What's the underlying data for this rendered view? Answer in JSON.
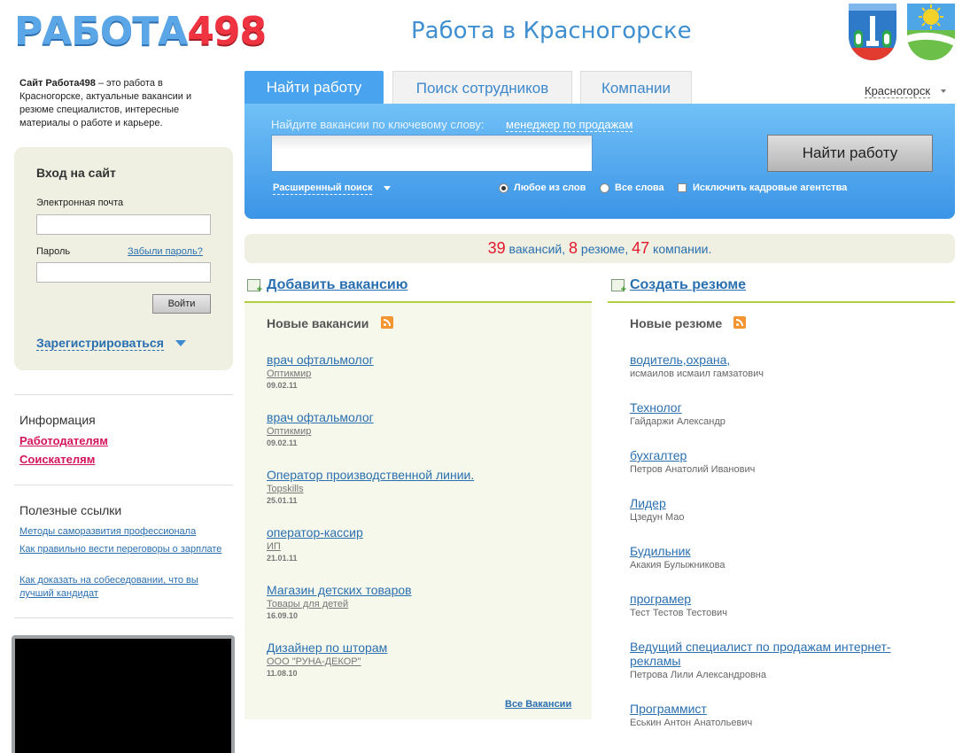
{
  "header": {
    "logo_part1": "РАБОТА",
    "logo_part2": "498",
    "title": "Работа в Красногорске"
  },
  "intro": {
    "site_name": "Сайт Работа498",
    "text": " – это работа в Красногорске, актуальные вакансии и резюме специалистов, интересные материалы о работе и карьере."
  },
  "login": {
    "title": "Вход на сайт",
    "email_label": "Электронная почта",
    "password_label": "Пароль",
    "forgot_link": "Забыли пароль?",
    "submit_label": "Войти",
    "register_link": "Зарегистрироваться"
  },
  "info": {
    "heading": "Информация",
    "links": [
      "Работодателям",
      "Соискателям"
    ]
  },
  "useful": {
    "heading": "Полезные ссылки",
    "links": [
      "Методы саморазвития профессионала",
      "Как правильно вести переговоры о зарплате",
      "Как доказать на собеседовании, что вы лучший кандидат"
    ]
  },
  "tabs": [
    "Найти работу",
    "Поиск сотрудников",
    "Компании"
  ],
  "city_selector": "Красногорск",
  "search": {
    "hint": "Найдите вакансии по ключевому слову:",
    "hint_example": "менеджер по продажам",
    "input_value": "",
    "button_label": "Найти работу",
    "advanced_link": "Расширенный поиск",
    "options": [
      "Любое из слов",
      "Все слова",
      "Исключить кадровые агентства"
    ]
  },
  "stats": {
    "vacancies_count": "39",
    "vacancies_label": "вакансий",
    "resumes_count": "8",
    "resumes_label": "резюме",
    "companies_count": "47",
    "companies_label": "компании"
  },
  "vacancies": {
    "add_link": "Добавить вакансию",
    "heading": "Новые вакансии",
    "all_link": "Все Вакансии",
    "items": [
      {
        "title": "врач офтальмолог",
        "company": "Оптикмир",
        "date": "09.02.11"
      },
      {
        "title": "врач офтальмолог",
        "company": "Оптикмир",
        "date": "09.02.11"
      },
      {
        "title": "Оператор производственной линии.",
        "company": "Topskills",
        "date": "25.01.11"
      },
      {
        "title": "оператор-кассир",
        "company": "ИП",
        "date": "21.01.11"
      },
      {
        "title": "Магазин детских товаров",
        "company": "Товары для детей",
        "date": "16.09.10"
      },
      {
        "title": "Дизайнер по шторам",
        "company": "ООО \"РУНА-ДЕКОР\"",
        "date": "11.08.10"
      }
    ]
  },
  "resumes": {
    "add_link": "Создать резюме",
    "heading": "Новые резюме",
    "items": [
      {
        "title": "водитель,охрана,",
        "name": "исмаилов исмаил гамзатович"
      },
      {
        "title": "Технолог",
        "name": "Гайдаржи Александр"
      },
      {
        "title": "бухгалтер",
        "name": "Петров Анатолий Иванович"
      },
      {
        "title": "Лидер",
        "name": "Цзедун Мао"
      },
      {
        "title": "Будильник",
        "name": "Акакия Булыжникова"
      },
      {
        "title": "програмер",
        "name": "Тест Тестов Тестович"
      },
      {
        "title": "Ведущий специалист по продажам интернет-рекламы",
        "name": "Петрова Лили Александровна"
      },
      {
        "title": "Программист",
        "name": "Еськин Антон Анатольевич"
      }
    ]
  },
  "colors": {
    "accent_blue": "#4aa3ee",
    "link_blue": "#2a6fb0",
    "stat_red": "#e4182c",
    "info_red": "#d4145a",
    "panel_beige": "#eff0e1",
    "divider_green": "#b2cf3e"
  }
}
